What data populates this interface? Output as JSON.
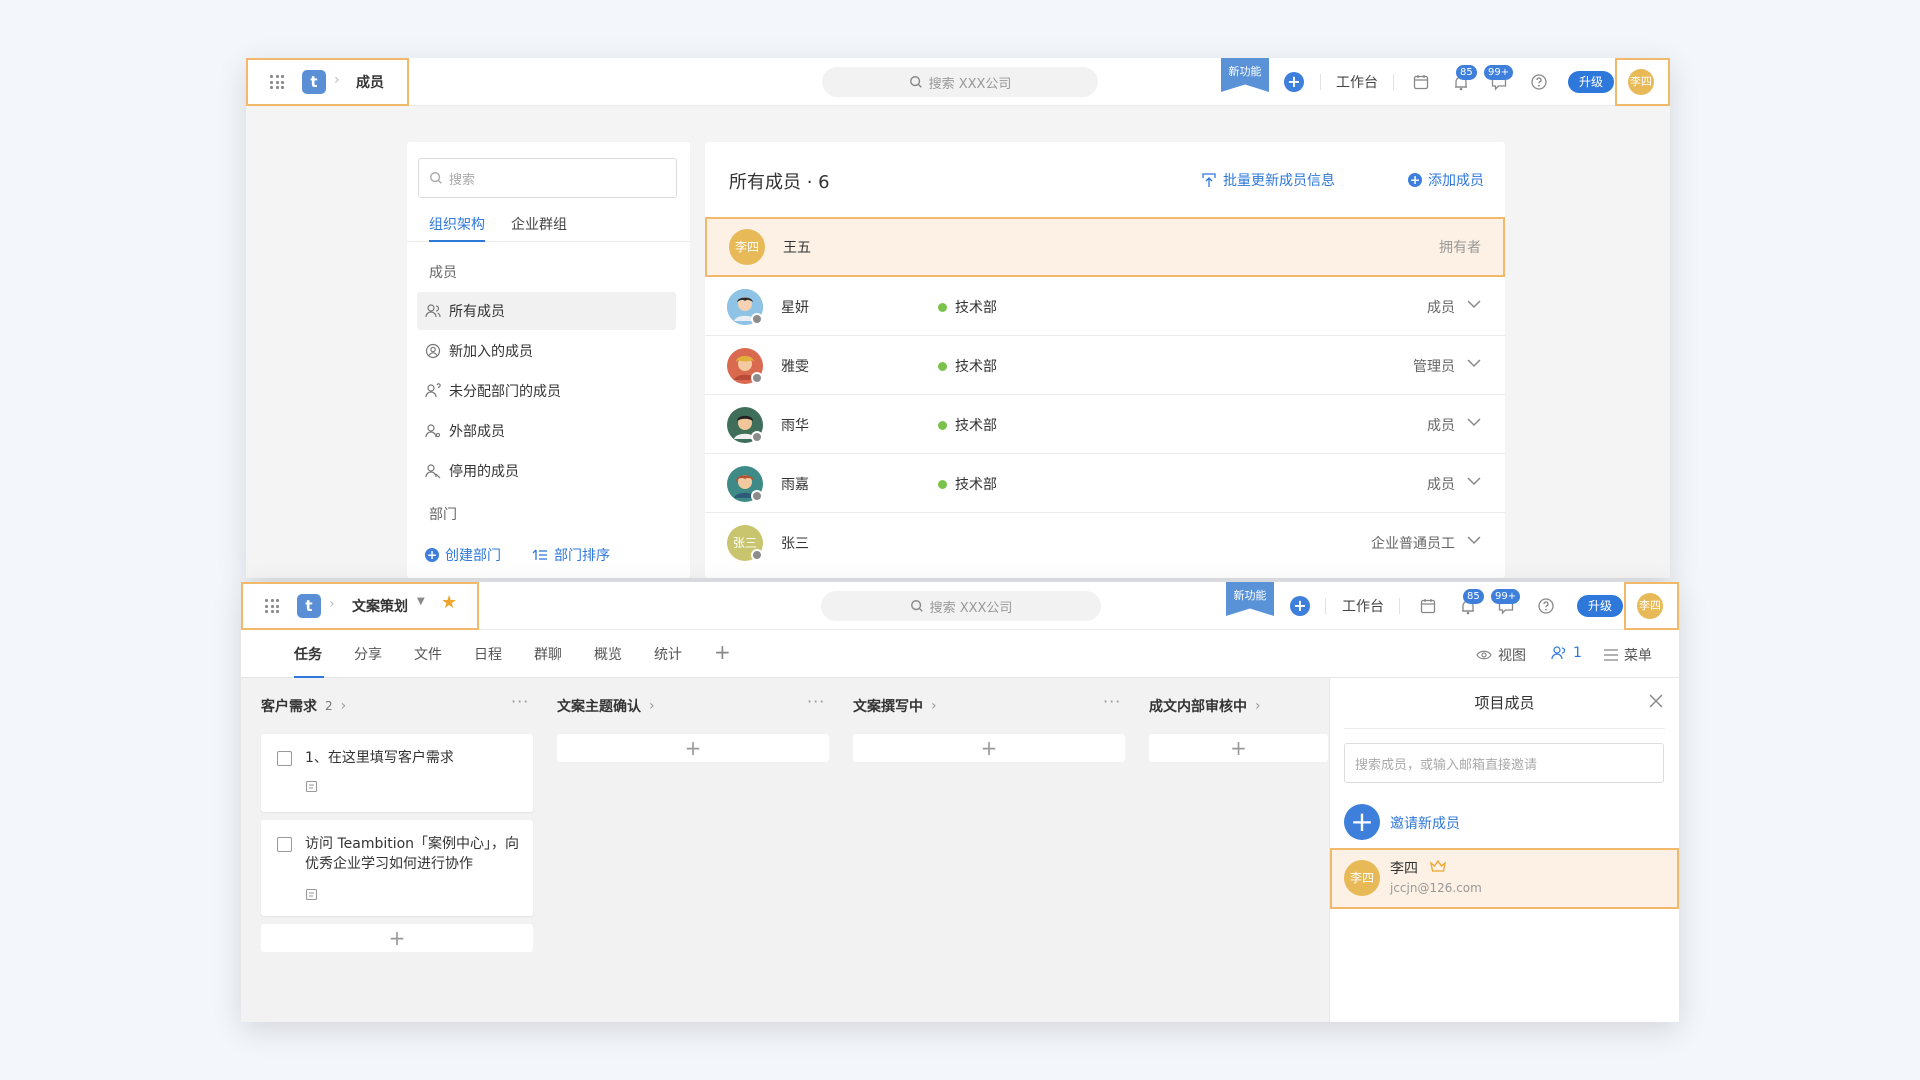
{
  "members_window": {
    "topbar": {
      "breadcrumb_title": "成员",
      "search_placeholder": "搜索 XXX公司",
      "new_feature": "新功能",
      "workbench": "工作台",
      "notify_count": "85",
      "message_count": "99+",
      "upgrade": "升级",
      "avatar_text": "李四"
    },
    "sidebar": {
      "search_placeholder": "搜索",
      "tabs": [
        "组织架构",
        "企业群组"
      ],
      "section_members": "成员",
      "items": [
        "所有成员",
        "新加入的成员",
        "未分配部门的成员",
        "外部成员",
        "停用的成员"
      ],
      "section_departments": "部门",
      "create_department": "创建部门",
      "sort_departments": "部门排序"
    },
    "main": {
      "title": "所有成员 · 6",
      "bulk_update": "批量更新成员信息",
      "add_member": "添加成员",
      "rows": [
        {
          "avatar": "李四",
          "name": "王五",
          "dept": "",
          "role": "拥有者"
        },
        {
          "avatar": "",
          "name": "星妍",
          "dept": "技术部",
          "role": "成员"
        },
        {
          "avatar": "",
          "name": "雅雯",
          "dept": "技术部",
          "role": "管理员"
        },
        {
          "avatar": "",
          "name": "雨华",
          "dept": "技术部",
          "role": "成员"
        },
        {
          "avatar": "",
          "name": "雨嘉",
          "dept": "技术部",
          "role": "成员"
        },
        {
          "avatar": "张三",
          "name": "张三",
          "dept": "",
          "role": "企业普通员工"
        }
      ]
    }
  },
  "project_window": {
    "topbar": {
      "project_name": "文案策划",
      "search_placeholder": "搜索 XXX公司",
      "new_feature": "新功能",
      "workbench": "工作台",
      "notify_count": "85",
      "message_count": "99+",
      "upgrade": "升级",
      "avatar_text": "李四"
    },
    "tabs": [
      "任务",
      "分享",
      "文件",
      "日程",
      "群聊",
      "概览",
      "统计"
    ],
    "toolbar": {
      "view": "视图",
      "member_count": "1",
      "menu": "菜单"
    },
    "columns": [
      {
        "title": "客户需求",
        "count": "2"
      },
      {
        "title": "文案主题确认",
        "count": ""
      },
      {
        "title": "文案撰写中",
        "count": ""
      },
      {
        "title": "成文内部审核中",
        "count": ""
      }
    ],
    "cards": [
      {
        "text": "1、在这里填写客户需求"
      },
      {
        "text": "访问 Teambition「案例中心」，向优秀企业学习如何进行协作"
      }
    ],
    "member_panel": {
      "title": "项目成员",
      "search_placeholder": "搜索成员，或输入邮箱直接邀请",
      "invite": "邀请新成员",
      "member": {
        "avatar": "李四",
        "name": "李四",
        "email": "jccjn@126.com"
      }
    }
  },
  "colors": {
    "accent": "#2f78db",
    "highlight_border": "#f2b96b",
    "highlight_fill": "#fcf1e4",
    "avatar": "#e8b957",
    "status_green": "#7ac24c"
  }
}
